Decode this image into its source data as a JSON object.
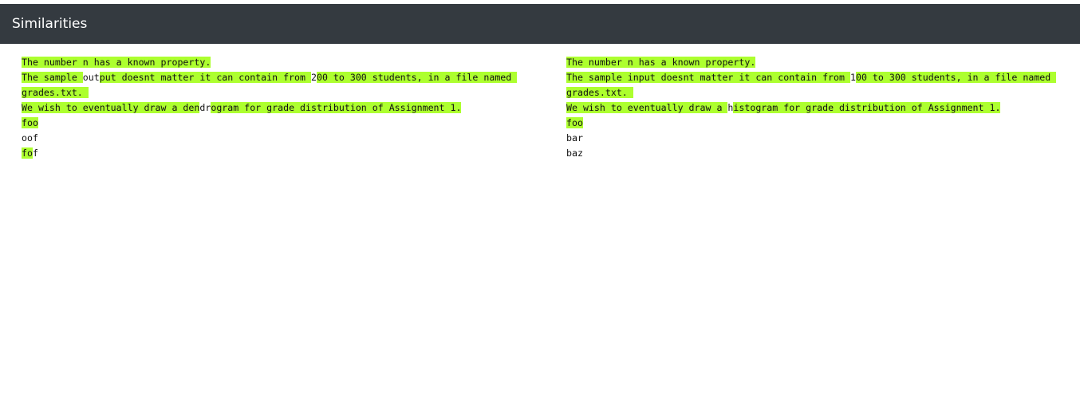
{
  "header": {
    "title": "Similarities"
  },
  "left_panel": {
    "lines": [
      [
        {
          "text": "The number n has a known property.",
          "hl": true
        }
      ],
      [
        {
          "text": "The sample ",
          "hl": true
        },
        {
          "text": "out",
          "hl": false
        },
        {
          "text": "put doesnt matter it can contain from ",
          "hl": true
        },
        {
          "text": "2",
          "hl": false
        },
        {
          "text": "00 to 300 students, in a file named grades.txt. ",
          "hl": true
        }
      ],
      [
        {
          "text": "We wish to eventually draw a den",
          "hl": true
        },
        {
          "text": "dr",
          "hl": false
        },
        {
          "text": "ogram for grade distribution of Assignment 1.",
          "hl": true
        }
      ],
      [
        {
          "text": "foo",
          "hl": true
        }
      ],
      [
        {
          "text": "oof",
          "hl": false
        }
      ],
      [
        {
          "text": "fo",
          "hl": true
        },
        {
          "text": "f",
          "hl": false
        }
      ]
    ]
  },
  "right_panel": {
    "lines": [
      [
        {
          "text": "The number n has a known property.",
          "hl": true
        }
      ],
      [
        {
          "text": "The sample input doesnt matter it can contain from ",
          "hl": true
        },
        {
          "text": "1",
          "hl": false
        },
        {
          "text": "00 to 300 students, in a file named grades.txt. ",
          "hl": true
        }
      ],
      [
        {
          "text": "We wish to eventually draw a ",
          "hl": true
        },
        {
          "text": "h",
          "hl": false
        },
        {
          "text": "istogram for grade distribution of Assignment 1.",
          "hl": true
        }
      ],
      [
        {
          "text": "foo",
          "hl": true
        }
      ],
      [
        {
          "text": "bar",
          "hl": false
        }
      ],
      [
        {
          "text": "baz",
          "hl": false
        }
      ]
    ]
  },
  "colors": {
    "header_bg": "#343a40",
    "highlight": "#adff2f"
  }
}
